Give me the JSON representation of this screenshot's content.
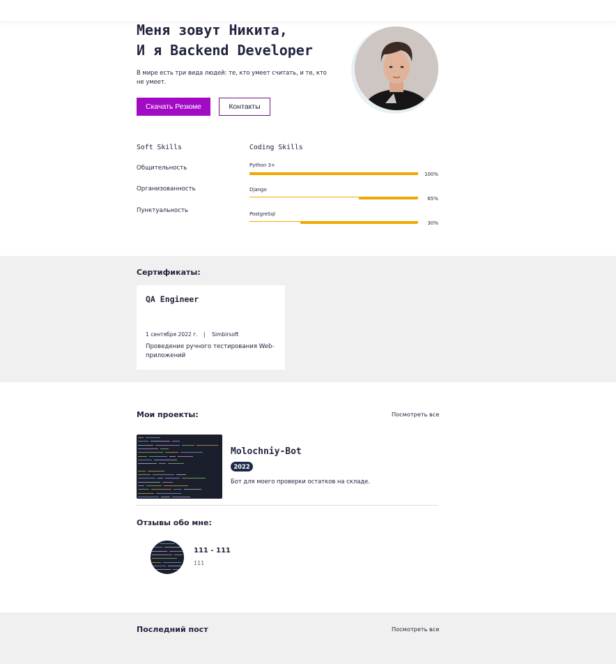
{
  "hero": {
    "title_line1": "Меня зовут Никита,",
    "title_line2": "И я Backend Developer",
    "description": "В мире есть три вида людей: те, кто умеет считать, и те, кто не умеет.",
    "download_button": "Скачать Резюме",
    "contacts_button": "Контакты",
    "avatar_icon": "person-photo-icon"
  },
  "skills": {
    "soft_title": "Soft Skills",
    "coding_title": "Coding Skills",
    "soft": [
      "Общительность",
      "Организованность",
      "Пунктуальность"
    ],
    "coding": [
      {
        "name": "Python 3+",
        "percent_label": "100%",
        "level": 1.0
      },
      {
        "name": "Django",
        "percent_label": "65%",
        "level": 0.35
      },
      {
        "name": "PostgreSql",
        "percent_label": "30%",
        "level": 0.7
      }
    ]
  },
  "certificates": {
    "heading": "Сертификаты:",
    "items": [
      {
        "title": "QA Engineer",
        "date": "1 сентября 2022 г.",
        "separator": "|",
        "issuer": "Simbirsoft",
        "description": "Проведение ручного тестирования Web-приложений"
      }
    ]
  },
  "projects": {
    "heading": "Мои проекты:",
    "see_all": "Посмотреть все",
    "items": [
      {
        "title": "Molochniy-Bot",
        "year": "2022",
        "description": "Бот для моего проверки остатков на складе.",
        "image_icon": "code-screenshot-icon"
      }
    ]
  },
  "reviews": {
    "heading": "Отзывы обо мне:",
    "items": [
      {
        "name": "111 - 111",
        "text": "111",
        "avatar_icon": "code-avatar-icon"
      }
    ]
  },
  "last_post": {
    "heading": "Последний пост",
    "see_all": "Посмотреть все"
  },
  "colors": {
    "accent": "#a20bc3",
    "skill_bar": "#f0a800",
    "badge": "#1d2a4b",
    "section_bg": "#f0f0f0"
  }
}
